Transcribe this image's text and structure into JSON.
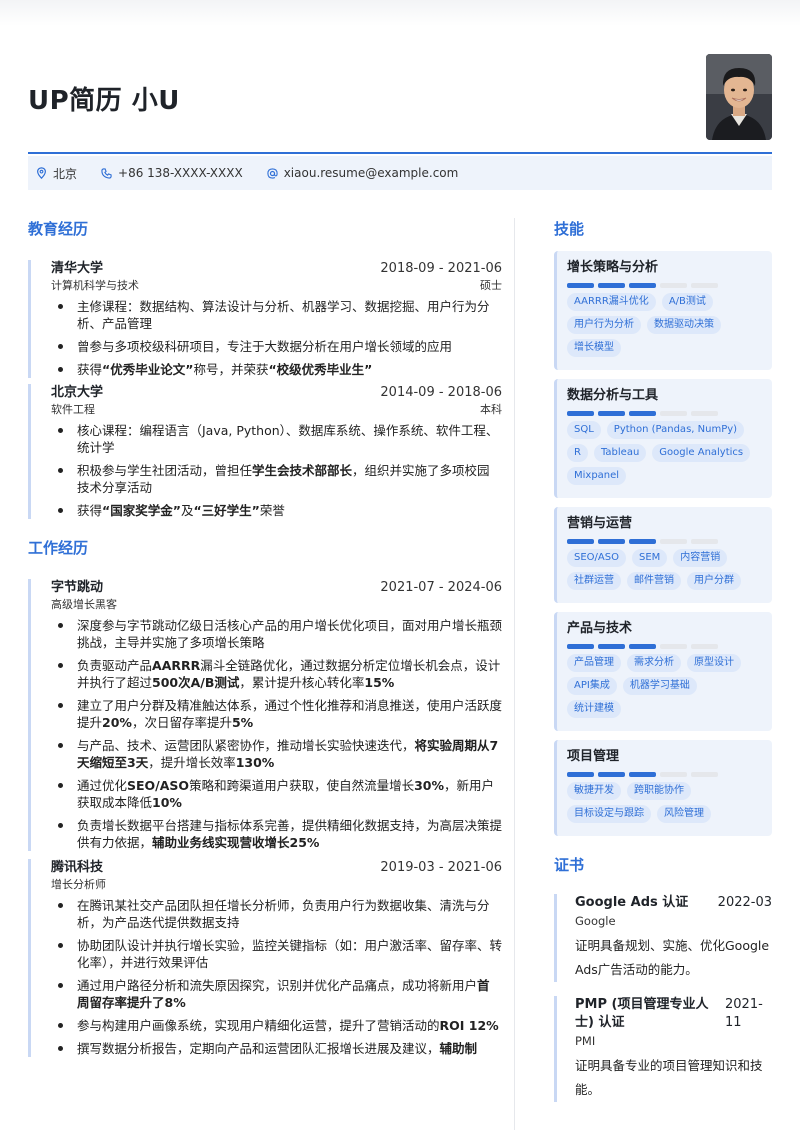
{
  "header": {
    "name": "UP简历 小U"
  },
  "contact": {
    "location": "北京",
    "phone": "+86 138-XXXX-XXXX",
    "email": "xiaou.resume@example.com"
  },
  "education": {
    "title": "教育经历",
    "entries": [
      {
        "school": "清华大学",
        "date": "2018-09 - 2021-06",
        "major": "计算机科学与技术",
        "degree": "硕士",
        "bullets": [
          [
            {
              "t": "主修课程：数据结构、算法设计与分析、机器学习、数据挖掘、用户行为分析、产品管理"
            }
          ],
          [
            {
              "t": "曾参与多项校级科研项目，专注于大数据分析在用户增长领域的应用"
            }
          ],
          [
            {
              "t": "获得"
            },
            {
              "t": "“优秀毕业论文”",
              "b": true
            },
            {
              "t": "称号，并荣获"
            },
            {
              "t": "“校级优秀毕业生”",
              "b": true
            }
          ]
        ]
      },
      {
        "school": "北京大学",
        "date": "2014-09 - 2018-06",
        "major": "软件工程",
        "degree": "本科",
        "bullets": [
          [
            {
              "t": "核心课程：编程语言（Java, Python）、数据库系统、操作系统、软件工程、统计学"
            }
          ],
          [
            {
              "t": "积极参与学生社团活动，曾担任"
            },
            {
              "t": "学生会技术部部长",
              "b": true
            },
            {
              "t": "，组织并实施了多项校园技术分享活动"
            }
          ],
          [
            {
              "t": "获得"
            },
            {
              "t": "“国家奖学金”",
              "b": true
            },
            {
              "t": "及"
            },
            {
              "t": "“三好学生”",
              "b": true
            },
            {
              "t": "荣誉"
            }
          ]
        ]
      }
    ]
  },
  "work": {
    "title": "工作经历",
    "entries": [
      {
        "company": "字节跳动",
        "date": "2021-07 - 2024-06",
        "role": "高级增长黑客",
        "bullets": [
          [
            {
              "t": "深度参与字节跳动亿级日活核心产品的用户增长优化项目，面对用户增长瓶颈挑战，主导并实施了多项增长策略"
            }
          ],
          [
            {
              "t": "负责驱动产品"
            },
            {
              "t": "AARRR",
              "b": true
            },
            {
              "t": "漏斗全链路优化，通过数据分析定位增长机会点，设计并执行了超过"
            },
            {
              "t": "500次A/B测试",
              "b": true
            },
            {
              "t": "，累计提升核心转化率"
            },
            {
              "t": "15%",
              "b": true
            }
          ],
          [
            {
              "t": "建立了用户分群及精准触达体系，通过个性化推荐和消息推送，使用户活跃度提升"
            },
            {
              "t": "20%",
              "b": true
            },
            {
              "t": "，次日留存率提升"
            },
            {
              "t": "5%",
              "b": true
            }
          ],
          [
            {
              "t": "与产品、技术、运营团队紧密协作，推动增长实验快速迭代，"
            },
            {
              "t": "将实验周期从7天缩短至3天",
              "b": true
            },
            {
              "t": "，提升增长效率"
            },
            {
              "t": "130%",
              "b": true
            }
          ],
          [
            {
              "t": "通过优化"
            },
            {
              "t": "SEO/ASO",
              "b": true
            },
            {
              "t": "策略和跨渠道用户获取，使自然流量增长"
            },
            {
              "t": "30%",
              "b": true
            },
            {
              "t": "，新用户获取成本降低"
            },
            {
              "t": "10%",
              "b": true
            }
          ],
          [
            {
              "t": "负责增长数据平台搭建与指标体系完善，提供精细化数据支持，为高层决策提供有力依据，"
            },
            {
              "t": "辅助业务线实现营收增长25%",
              "b": true
            }
          ]
        ]
      },
      {
        "company": "腾讯科技",
        "date": "2019-03 - 2021-06",
        "role": "增长分析师",
        "bullets": [
          [
            {
              "t": "在腾讯某社交产品团队担任增长分析师，负责用户行为数据收集、清洗与分析，为产品迭代提供数据支持"
            }
          ],
          [
            {
              "t": "协助团队设计并执行增长实验，监控关键指标（如：用户激活率、留存率、转化率），并进行效果评估"
            }
          ],
          [
            {
              "t": "通过用户路径分析和流失原因探究，识别并优化产品痛点，成功将新用户"
            },
            {
              "t": "首周留存率提升了8%",
              "b": true
            }
          ],
          [
            {
              "t": "参与构建用户画像系统，实现用户精细化运营，提升了营销活动的"
            },
            {
              "t": "ROI 12%",
              "b": true
            }
          ],
          [
            {
              "t": "撰写数据分析报告，定期向产品和运营团队汇报增长进展及建议，"
            },
            {
              "t": "辅助制",
              "b": true
            }
          ]
        ]
      }
    ]
  },
  "skills": {
    "title": "技能",
    "groups": [
      {
        "name": "增长策略与分析",
        "level": 0.6,
        "tags": [
          "AARRR漏斗优化",
          "A/B测试",
          "用户行为分析",
          "数据驱动决策",
          "增长模型"
        ]
      },
      {
        "name": "数据分析与工具",
        "level": 0.6,
        "tags": [
          "SQL",
          "Python (Pandas, NumPy)",
          "R",
          "Tableau",
          "Google Analytics",
          "Mixpanel"
        ]
      },
      {
        "name": "营销与运营",
        "level": 0.6,
        "tags": [
          "SEO/ASO",
          "SEM",
          "内容营销",
          "社群运营",
          "邮件营销",
          "用户分群"
        ]
      },
      {
        "name": "产品与技术",
        "level": 0.6,
        "tags": [
          "产品管理",
          "需求分析",
          "原型设计",
          "API集成",
          "机器学习基础",
          "统计建模"
        ]
      },
      {
        "name": "项目管理",
        "level": 0.6,
        "tags": [
          "敏捷开发",
          "跨职能协作",
          "目标设定与跟踪",
          "风险管理"
        ]
      }
    ]
  },
  "certificates": {
    "title": "证书",
    "items": [
      {
        "name": "Google Ads 认证",
        "date": "2022-03",
        "org": "Google",
        "desc": "证明具备规划、实施、优化Google Ads广告活动的能力。"
      },
      {
        "name": "PMP (项目管理专业人士) 认证",
        "date": "2021-11",
        "org": "PMI",
        "desc": "证明具备专业的项目管理知识和技能。"
      }
    ]
  },
  "colors": {
    "accent": "#2f6fd6",
    "contact_bg": "#eef3fb",
    "tag_bg": "#dde8fa"
  },
  "icons": {
    "location": "location-pin-icon",
    "phone": "phone-icon",
    "email": "at-sign-icon"
  }
}
